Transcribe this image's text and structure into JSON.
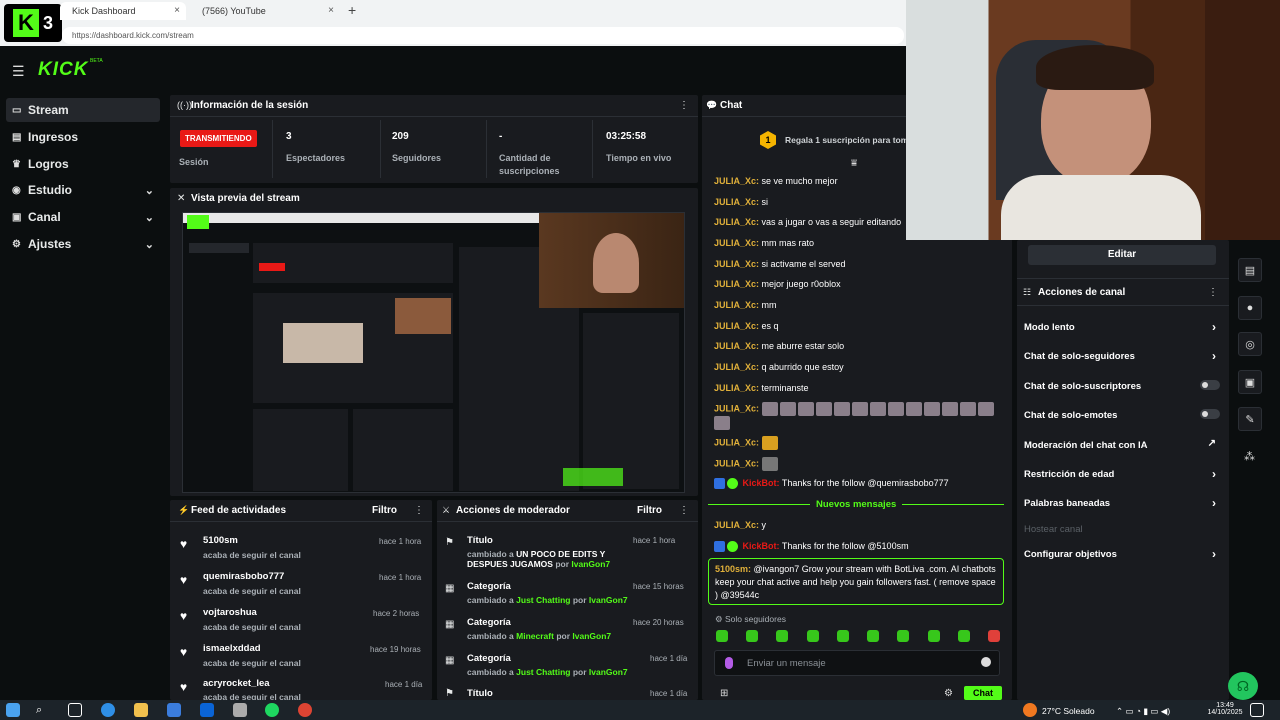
{
  "browser": {
    "tabs": [
      {
        "title": "Kick Dashboard",
        "close": "×"
      },
      {
        "title": "(7566) YouTube",
        "close": "×"
      }
    ],
    "new_tab": "+",
    "url": "https://dashboard.kick.com/stream",
    "badge_number": "3",
    "badge_letter": "K"
  },
  "app": {
    "logo": "KICK",
    "logo_badge": "BETA",
    "menu_icon": "hamburger-icon"
  },
  "sidebar": {
    "items": [
      {
        "label": "Stream",
        "icon": "monitor-icon",
        "active": true
      },
      {
        "label": "Ingresos",
        "icon": "wallet-icon"
      },
      {
        "label": "Logros",
        "icon": "trophy-icon"
      },
      {
        "label": "Estudio",
        "icon": "studio-icon",
        "chevron": "⌄"
      },
      {
        "label": "Canal",
        "icon": "channel-icon",
        "chevron": "⌄"
      },
      {
        "label": "Ajustes",
        "icon": "gear-icon",
        "chevron": "⌄"
      }
    ]
  },
  "session": {
    "title": "Información de la sesión",
    "status": "TRANSMITIENDO",
    "status_label": "Sesión",
    "stats": [
      {
        "value": "3",
        "label": "Espectadores"
      },
      {
        "value": "209",
        "label": "Seguidores"
      },
      {
        "value": "-",
        "label": "Cantidad de suscripciones"
      },
      {
        "value": "03:25:58",
        "label": "Tiempo en vivo"
      }
    ]
  },
  "preview": {
    "title": "Vista previa del stream"
  },
  "activity_feed": {
    "title": "Feed de actividades",
    "filter": "Filtro",
    "items": [
      {
        "name": "5100sm",
        "action": "acaba de seguir el canal",
        "time": "hace 1 hora"
      },
      {
        "name": "quemirasbobo777",
        "action": "acaba de seguir el canal",
        "time": "hace 1 hora"
      },
      {
        "name": "vojtaroshua",
        "action": "acaba de seguir el canal",
        "time": "hace 2 horas"
      },
      {
        "name": "ismaelxddad",
        "action": "acaba de seguir el canal",
        "time": "hace 19 horas"
      },
      {
        "name": "acryrocket_lea",
        "action": "acaba de seguir el canal",
        "time": "hace 1 día"
      }
    ]
  },
  "moderator_actions": {
    "title": "Acciones de moderador",
    "filter": "Filtro",
    "items": [
      {
        "type": "Título",
        "prefix": "cambiado a",
        "value": "UN POCO DE EDITS Y DESPUES JUGAMOS",
        "by": "por",
        "user": "IvanGon7",
        "time": "hace 1 hora"
      },
      {
        "type": "Categoría",
        "prefix": "cambiado a",
        "value": "Just Chatting",
        "by": "por",
        "user": "IvanGon7",
        "time": "hace 15 horas"
      },
      {
        "type": "Categoría",
        "prefix": "cambiado a",
        "value": "Minecraft",
        "by": "por",
        "user": "IvanGon7",
        "time": "hace 20 horas"
      },
      {
        "type": "Categoría",
        "prefix": "cambiado a",
        "value": "Just Chatting",
        "by": "por",
        "user": "IvanGon7",
        "time": "hace 1 día"
      },
      {
        "type": "Título",
        "prefix": "",
        "value": "",
        "by": "",
        "user": "",
        "time": "hace 1 día"
      }
    ]
  },
  "chat": {
    "title": "Chat",
    "promo": "Regala 1 suscripción para toma",
    "messages": [
      {
        "user": "JULIA_Xc:",
        "text": "se ve mucho mejor"
      },
      {
        "user": "JULIA_Xc:",
        "text": "si"
      },
      {
        "user": "JULIA_Xc:",
        "text": "vas a jugar o vas a seguir editando"
      },
      {
        "user": "JULIA_Xc:",
        "text": "mm mas rato"
      },
      {
        "user": "JULIA_Xc:",
        "text": "si activame el served"
      },
      {
        "user": "JULIA_Xc:",
        "text": "mejor juego r0oblox"
      },
      {
        "user": "JULIA_Xc:",
        "text": "mm"
      },
      {
        "user": "JULIA_Xc:",
        "text": "es q"
      },
      {
        "user": "JULIA_Xc:",
        "text": "me aburre estar solo"
      },
      {
        "user": "JULIA_Xc:",
        "text": "q aburrido que estoy"
      },
      {
        "user": "JULIA_Xc:",
        "text": "terminanste"
      }
    ],
    "emote_user": "JULIA_Xc:",
    "bot_name": "KickBot:",
    "bot_msg1": "Thanks for the follow @quemirasbobo777",
    "new_messages": "Nuevos mensajes",
    "after_user": "JULIA_Xc:",
    "after_text": "y",
    "bot_msg2": "Thanks for the follow @5100sm",
    "highlight_user": "5100sm:",
    "highlight_text": "@ivangon7 Grow your stream with BotLiva .com. AI chatbots keep your chat active and help you gain followers fast. ( remove space ) @39544c",
    "mode": "Solo seguidores",
    "input_placeholder": "Enviar un mensaje",
    "send": "Chat"
  },
  "channel_actions": {
    "edit": "Editar",
    "title": "Acciones de canal",
    "items": [
      {
        "label": "Modo lento",
        "control": "arrow"
      },
      {
        "label": "Chat de solo-seguidores",
        "control": "arrow"
      },
      {
        "label": "Chat de solo-suscriptores",
        "control": "toggle"
      },
      {
        "label": "Chat de solo-emotes",
        "control": "toggle"
      },
      {
        "label": "Moderación del chat con IA",
        "control": "external"
      },
      {
        "label": "Restricción de edad",
        "control": "arrow"
      },
      {
        "label": "Palabras baneadas",
        "control": "arrow"
      },
      {
        "label": "Hostear canal",
        "control": "none"
      },
      {
        "label": "Configurar objetivos",
        "control": "arrow"
      }
    ]
  },
  "taskbar": {
    "weather": "27°C  Soleado",
    "time": "13:49",
    "date": "14/10/2025"
  },
  "colors": {
    "accent": "#53fc18",
    "live": "#e91916",
    "panel": "#191b1f",
    "bg": "#0b0e0f",
    "username": "#e0b03a",
    "bot": "#e91916"
  }
}
